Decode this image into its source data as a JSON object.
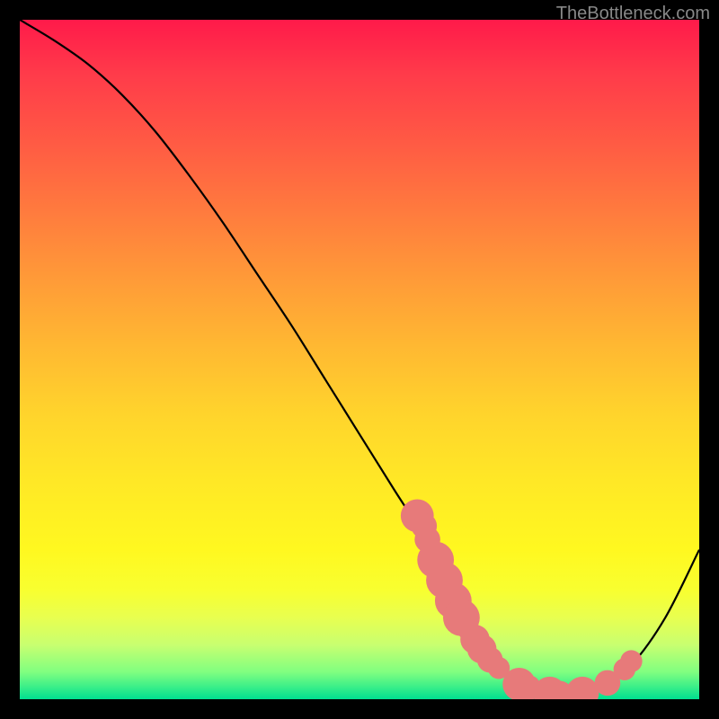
{
  "attribution": "TheBottleneck.com",
  "chart_data": {
    "type": "line",
    "title": "",
    "xlabel": "",
    "ylabel": "",
    "xlim": [
      0,
      100
    ],
    "ylim": [
      0,
      100
    ],
    "grid": false,
    "legend": false,
    "series": [
      {
        "name": "bottleneck-curve",
        "x": [
          0,
          5,
          10,
          15,
          20,
          25,
          30,
          35,
          40,
          45,
          50,
          55,
          60,
          63,
          65,
          70,
          75,
          78,
          82,
          86,
          90,
          95,
          100
        ],
        "y": [
          100,
          97,
          93.5,
          89,
          83.5,
          77,
          70,
          62.5,
          55,
          47,
          39,
          31,
          23,
          16,
          12,
          5,
          1.5,
          0.7,
          0.7,
          2,
          5,
          12,
          22
        ]
      }
    ],
    "markers": [
      {
        "x": 58.5,
        "y": 27.0,
        "r": 1.8
      },
      {
        "x": 59.5,
        "y": 25.5,
        "r": 1.4
      },
      {
        "x": 60.0,
        "y": 23.5,
        "r": 1.4
      },
      {
        "x": 61.2,
        "y": 20.5,
        "r": 2.0
      },
      {
        "x": 62.5,
        "y": 17.5,
        "r": 2.0
      },
      {
        "x": 63.8,
        "y": 14.5,
        "r": 2.0
      },
      {
        "x": 65.0,
        "y": 12.0,
        "r": 2.0
      },
      {
        "x": 66.0,
        "y": 10.3,
        "r": 1.2
      },
      {
        "x": 67.0,
        "y": 8.8,
        "r": 1.6
      },
      {
        "x": 68.0,
        "y": 7.4,
        "r": 1.6
      },
      {
        "x": 69.2,
        "y": 5.8,
        "r": 1.4
      },
      {
        "x": 70.5,
        "y": 4.6,
        "r": 1.2
      },
      {
        "x": 73.5,
        "y": 2.2,
        "r": 1.8
      },
      {
        "x": 74.8,
        "y": 1.7,
        "r": 1.4
      },
      {
        "x": 78.0,
        "y": 0.9,
        "r": 1.8
      },
      {
        "x": 79.5,
        "y": 0.8,
        "r": 1.4
      },
      {
        "x": 82.8,
        "y": 0.9,
        "r": 1.8
      },
      {
        "x": 86.5,
        "y": 2.4,
        "r": 1.4
      },
      {
        "x": 89.0,
        "y": 4.4,
        "r": 1.2
      },
      {
        "x": 90.0,
        "y": 5.6,
        "r": 1.2
      }
    ],
    "colors": {
      "curve_stroke": "#000000",
      "marker_fill": "#e77a7a"
    }
  }
}
